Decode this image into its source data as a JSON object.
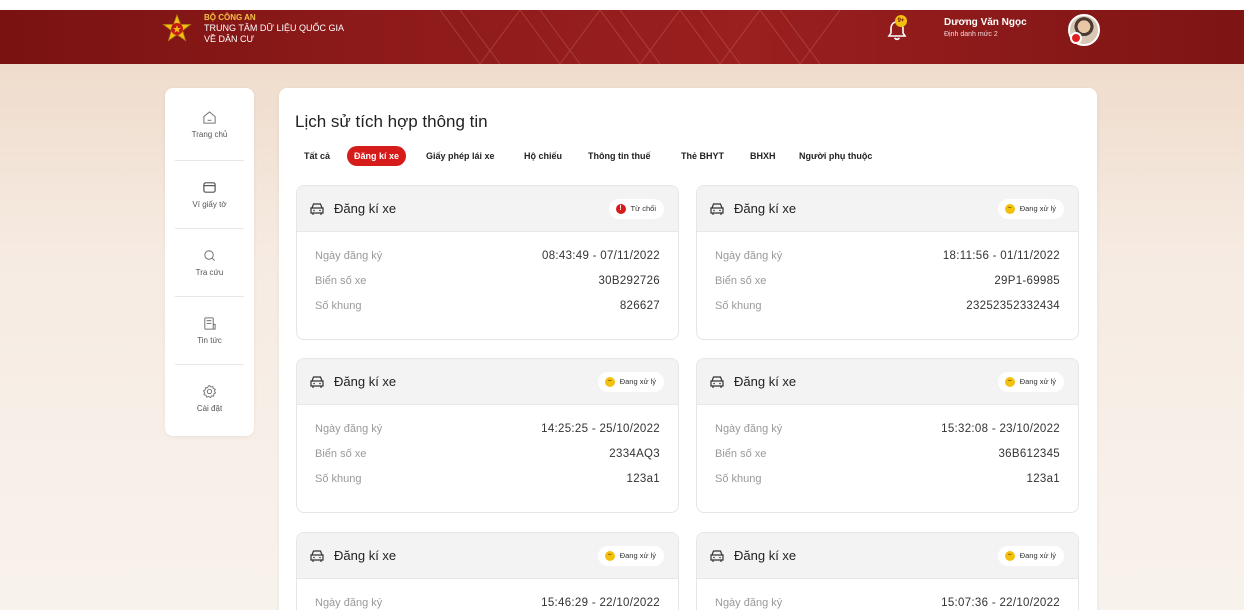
{
  "header": {
    "brand_line1": "BỘ CÔNG AN",
    "brand_line2": "TRUNG TÂM DỮ LIỆU QUỐC GIA",
    "brand_line3": "VỀ DÂN CƯ",
    "notification_badge": "9+",
    "user_name": "Dương Văn Ngọc",
    "user_level": "Định danh mức 2",
    "brand_color": "#8d1a1a"
  },
  "sidebar": {
    "items": [
      {
        "label": "Trang chủ",
        "icon": "home-icon"
      },
      {
        "label": "Ví giấy tờ",
        "icon": "wallet-icon"
      },
      {
        "label": "Tra cứu",
        "icon": "search-icon"
      },
      {
        "label": "Tin tức",
        "icon": "news-icon"
      },
      {
        "label": "Cài đặt",
        "icon": "gear-icon"
      }
    ]
  },
  "main": {
    "title": "Lịch sử tích hợp thông tin",
    "tabs": [
      {
        "label": "Tất cả",
        "active": false
      },
      {
        "label": "Đăng kí xe",
        "active": true
      },
      {
        "label": "Giấy phép lái xe",
        "active": false
      },
      {
        "label": "Hộ chiếu",
        "active": false
      },
      {
        "label": "Thông tin thuế",
        "active": false
      },
      {
        "label": "Thẻ BHYT",
        "active": false
      },
      {
        "label": "BHXH",
        "active": false
      },
      {
        "label": "Người phụ thuộc",
        "active": false
      }
    ],
    "field_labels": {
      "date": "Ngày đăng ký",
      "plate": "Biển số xe",
      "frame": "Số khung"
    },
    "cards": [
      {
        "title": "Đăng kí xe",
        "status": "Từ chối",
        "status_type": "reject",
        "date": "08:43:49 - 07/11/2022",
        "plate": "30B292726",
        "frame": "826627"
      },
      {
        "title": "Đăng kí xe",
        "status": "Đang xử lý",
        "status_type": "pending",
        "date": "18:11:56 - 01/11/2022",
        "plate": "29P1-69985",
        "frame": "23252352332434"
      },
      {
        "title": "Đăng kí xe",
        "status": "Đang xử lý",
        "status_type": "pending",
        "date": "14:25:25 - 25/10/2022",
        "plate": "2334AQ3",
        "frame": "123a1"
      },
      {
        "title": "Đăng kí xe",
        "status": "Đang xử lý",
        "status_type": "pending",
        "date": "15:32:08 - 23/10/2022",
        "plate": "36B612345",
        "frame": "123a1"
      },
      {
        "title": "Đăng kí xe",
        "status": "Đang xử lý",
        "status_type": "pending",
        "date": "15:46:29 - 22/10/2022"
      },
      {
        "title": "Đăng kí xe",
        "status": "Đang xử lý",
        "status_type": "pending",
        "date": "15:07:36 - 22/10/2022"
      }
    ],
    "status_colors": {
      "reject": "#d61b1b",
      "pending": "#f2c10e"
    }
  }
}
